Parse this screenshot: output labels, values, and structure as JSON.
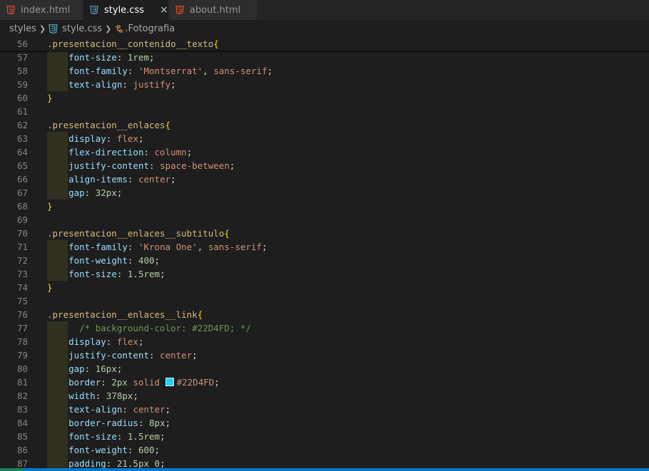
{
  "tabs": [
    {
      "label": "index.html",
      "type": "html"
    },
    {
      "label": "style.css",
      "type": "css",
      "active": true,
      "close": "×"
    },
    {
      "label": "about.html",
      "type": "html"
    }
  ],
  "breadcrumb": {
    "folder": "styles",
    "file": "style.css",
    "symbol": ".Fotografia"
  },
  "colors": {
    "html_icon": "#e44d26",
    "css_icon": "#519aba",
    "swatch": "#22D4FD"
  },
  "lines": [
    {
      "n": "56",
      "tokens": [
        {
          "c": "sel",
          "t": ".presentacion__contenido__texto"
        },
        {
          "c": "brace",
          "t": "{"
        }
      ]
    },
    {
      "n": "57",
      "tokens": [
        {
          "c": "plain",
          "t": "    "
        },
        {
          "c": "prop",
          "t": "font-size"
        },
        {
          "c": "plain",
          "t": ": "
        },
        {
          "c": "num",
          "t": "1rem"
        },
        {
          "c": "plain",
          "t": ";"
        }
      ]
    },
    {
      "n": "58",
      "tokens": [
        {
          "c": "plain",
          "t": "    "
        },
        {
          "c": "prop",
          "t": "font-family"
        },
        {
          "c": "plain",
          "t": ": "
        },
        {
          "c": "str",
          "t": "'Montserrat'"
        },
        {
          "c": "plain",
          "t": ", "
        },
        {
          "c": "str",
          "t": "sans-serif"
        },
        {
          "c": "plain",
          "t": ";"
        }
      ]
    },
    {
      "n": "59",
      "tokens": [
        {
          "c": "plain",
          "t": "    "
        },
        {
          "c": "prop",
          "t": "text-align"
        },
        {
          "c": "plain",
          "t": ": "
        },
        {
          "c": "str",
          "t": "justify"
        },
        {
          "c": "plain",
          "t": ";"
        }
      ]
    },
    {
      "n": "60",
      "tokens": [
        {
          "c": "brace",
          "t": "}"
        }
      ]
    },
    {
      "n": "61",
      "tokens": []
    },
    {
      "n": "62",
      "tokens": [
        {
          "c": "sel",
          "t": ".presentacion__enlaces"
        },
        {
          "c": "brace",
          "t": "{"
        }
      ]
    },
    {
      "n": "63",
      "tokens": [
        {
          "c": "plain",
          "t": "    "
        },
        {
          "c": "prop",
          "t": "display"
        },
        {
          "c": "plain",
          "t": ": "
        },
        {
          "c": "str",
          "t": "flex"
        },
        {
          "c": "plain",
          "t": ";"
        }
      ]
    },
    {
      "n": "64",
      "tokens": [
        {
          "c": "plain",
          "t": "    "
        },
        {
          "c": "prop",
          "t": "flex-direction"
        },
        {
          "c": "plain",
          "t": ": "
        },
        {
          "c": "str",
          "t": "column"
        },
        {
          "c": "plain",
          "t": ";"
        }
      ]
    },
    {
      "n": "65",
      "tokens": [
        {
          "c": "plain",
          "t": "    "
        },
        {
          "c": "prop",
          "t": "justify-content"
        },
        {
          "c": "plain",
          "t": ": "
        },
        {
          "c": "str",
          "t": "space-between"
        },
        {
          "c": "plain",
          "t": ";"
        }
      ]
    },
    {
      "n": "66",
      "tokens": [
        {
          "c": "plain",
          "t": "    "
        },
        {
          "c": "prop",
          "t": "align-items"
        },
        {
          "c": "plain",
          "t": ": "
        },
        {
          "c": "str",
          "t": "center"
        },
        {
          "c": "plain",
          "t": ";"
        }
      ]
    },
    {
      "n": "67",
      "tokens": [
        {
          "c": "plain",
          "t": "    "
        },
        {
          "c": "prop",
          "t": "gap"
        },
        {
          "c": "plain",
          "t": ": "
        },
        {
          "c": "num",
          "t": "32px"
        },
        {
          "c": "plain",
          "t": ";"
        }
      ]
    },
    {
      "n": "68",
      "tokens": [
        {
          "c": "brace",
          "t": "}"
        }
      ]
    },
    {
      "n": "69",
      "tokens": []
    },
    {
      "n": "70",
      "tokens": [
        {
          "c": "sel",
          "t": ".presentacion__enlaces__subtitulo"
        },
        {
          "c": "brace",
          "t": "{"
        }
      ]
    },
    {
      "n": "71",
      "tokens": [
        {
          "c": "plain",
          "t": "    "
        },
        {
          "c": "prop",
          "t": "font-family"
        },
        {
          "c": "plain",
          "t": ": "
        },
        {
          "c": "str",
          "t": "'Krona One'"
        },
        {
          "c": "plain",
          "t": ", "
        },
        {
          "c": "str",
          "t": "sans-serif"
        },
        {
          "c": "plain",
          "t": ";"
        }
      ]
    },
    {
      "n": "72",
      "tokens": [
        {
          "c": "plain",
          "t": "    "
        },
        {
          "c": "prop",
          "t": "font-weight"
        },
        {
          "c": "plain",
          "t": ": "
        },
        {
          "c": "num",
          "t": "400"
        },
        {
          "c": "plain",
          "t": ";"
        }
      ]
    },
    {
      "n": "73",
      "tokens": [
        {
          "c": "plain",
          "t": "    "
        },
        {
          "c": "prop",
          "t": "font-size"
        },
        {
          "c": "plain",
          "t": ": "
        },
        {
          "c": "num",
          "t": "1.5rem"
        },
        {
          "c": "plain",
          "t": ";"
        }
      ]
    },
    {
      "n": "74",
      "tokens": [
        {
          "c": "brace",
          "t": "}"
        }
      ]
    },
    {
      "n": "75",
      "tokens": []
    },
    {
      "n": "76",
      "tokens": [
        {
          "c": "sel",
          "t": ".presentacion__enlaces__link"
        },
        {
          "c": "brace",
          "t": "{"
        }
      ]
    },
    {
      "n": "77",
      "tokens": [
        {
          "c": "plain",
          "t": "      "
        },
        {
          "c": "cmt",
          "t": "/* background-color: #22D4FD; */"
        }
      ]
    },
    {
      "n": "78",
      "tokens": [
        {
          "c": "plain",
          "t": "    "
        },
        {
          "c": "prop",
          "t": "display"
        },
        {
          "c": "plain",
          "t": ": "
        },
        {
          "c": "str",
          "t": "flex"
        },
        {
          "c": "plain",
          "t": ";"
        }
      ]
    },
    {
      "n": "79",
      "tokens": [
        {
          "c": "plain",
          "t": "    "
        },
        {
          "c": "prop",
          "t": "justify-content"
        },
        {
          "c": "plain",
          "t": ": "
        },
        {
          "c": "str",
          "t": "center"
        },
        {
          "c": "plain",
          "t": ";"
        }
      ]
    },
    {
      "n": "80",
      "tokens": [
        {
          "c": "plain",
          "t": "    "
        },
        {
          "c": "prop",
          "t": "gap"
        },
        {
          "c": "plain",
          "t": ": "
        },
        {
          "c": "num",
          "t": "16px"
        },
        {
          "c": "plain",
          "t": ";"
        }
      ]
    },
    {
      "n": "81",
      "tokens": [
        {
          "c": "plain",
          "t": "    "
        },
        {
          "c": "prop",
          "t": "border"
        },
        {
          "c": "plain",
          "t": ": "
        },
        {
          "c": "num",
          "t": "2px"
        },
        {
          "c": "plain",
          "t": " "
        },
        {
          "c": "str",
          "t": "solid"
        },
        {
          "c": "plain",
          "t": " "
        },
        {
          "c": "swatch",
          "t": ""
        },
        {
          "c": "str",
          "t": "#22D4FD"
        },
        {
          "c": "plain",
          "t": ";"
        }
      ]
    },
    {
      "n": "82",
      "tokens": [
        {
          "c": "plain",
          "t": "    "
        },
        {
          "c": "prop",
          "t": "width"
        },
        {
          "c": "plain",
          "t": ": "
        },
        {
          "c": "num",
          "t": "378px"
        },
        {
          "c": "plain",
          "t": ";"
        }
      ]
    },
    {
      "n": "83",
      "tokens": [
        {
          "c": "plain",
          "t": "    "
        },
        {
          "c": "prop",
          "t": "text-align"
        },
        {
          "c": "plain",
          "t": ": "
        },
        {
          "c": "str",
          "t": "center"
        },
        {
          "c": "plain",
          "t": ";"
        }
      ]
    },
    {
      "n": "84",
      "tokens": [
        {
          "c": "plain",
          "t": "    "
        },
        {
          "c": "prop",
          "t": "border-radius"
        },
        {
          "c": "plain",
          "t": ": "
        },
        {
          "c": "num",
          "t": "8px"
        },
        {
          "c": "plain",
          "t": ";"
        }
      ]
    },
    {
      "n": "85",
      "tokens": [
        {
          "c": "plain",
          "t": "    "
        },
        {
          "c": "prop",
          "t": "font-size"
        },
        {
          "c": "plain",
          "t": ": "
        },
        {
          "c": "num",
          "t": "1.5rem"
        },
        {
          "c": "plain",
          "t": ";"
        }
      ]
    },
    {
      "n": "86",
      "tokens": [
        {
          "c": "plain",
          "t": "    "
        },
        {
          "c": "prop",
          "t": "font-weight"
        },
        {
          "c": "plain",
          "t": ": "
        },
        {
          "c": "num",
          "t": "600"
        },
        {
          "c": "plain",
          "t": ";"
        }
      ]
    },
    {
      "n": "87",
      "tokens": [
        {
          "c": "plain",
          "t": "    "
        },
        {
          "c": "prop",
          "t": "padding"
        },
        {
          "c": "plain",
          "t": ": "
        },
        {
          "c": "num",
          "t": "21.5px"
        },
        {
          "c": "plain",
          "t": " "
        },
        {
          "c": "num",
          "t": "0"
        },
        {
          "c": "plain",
          "t": ";"
        }
      ]
    }
  ]
}
